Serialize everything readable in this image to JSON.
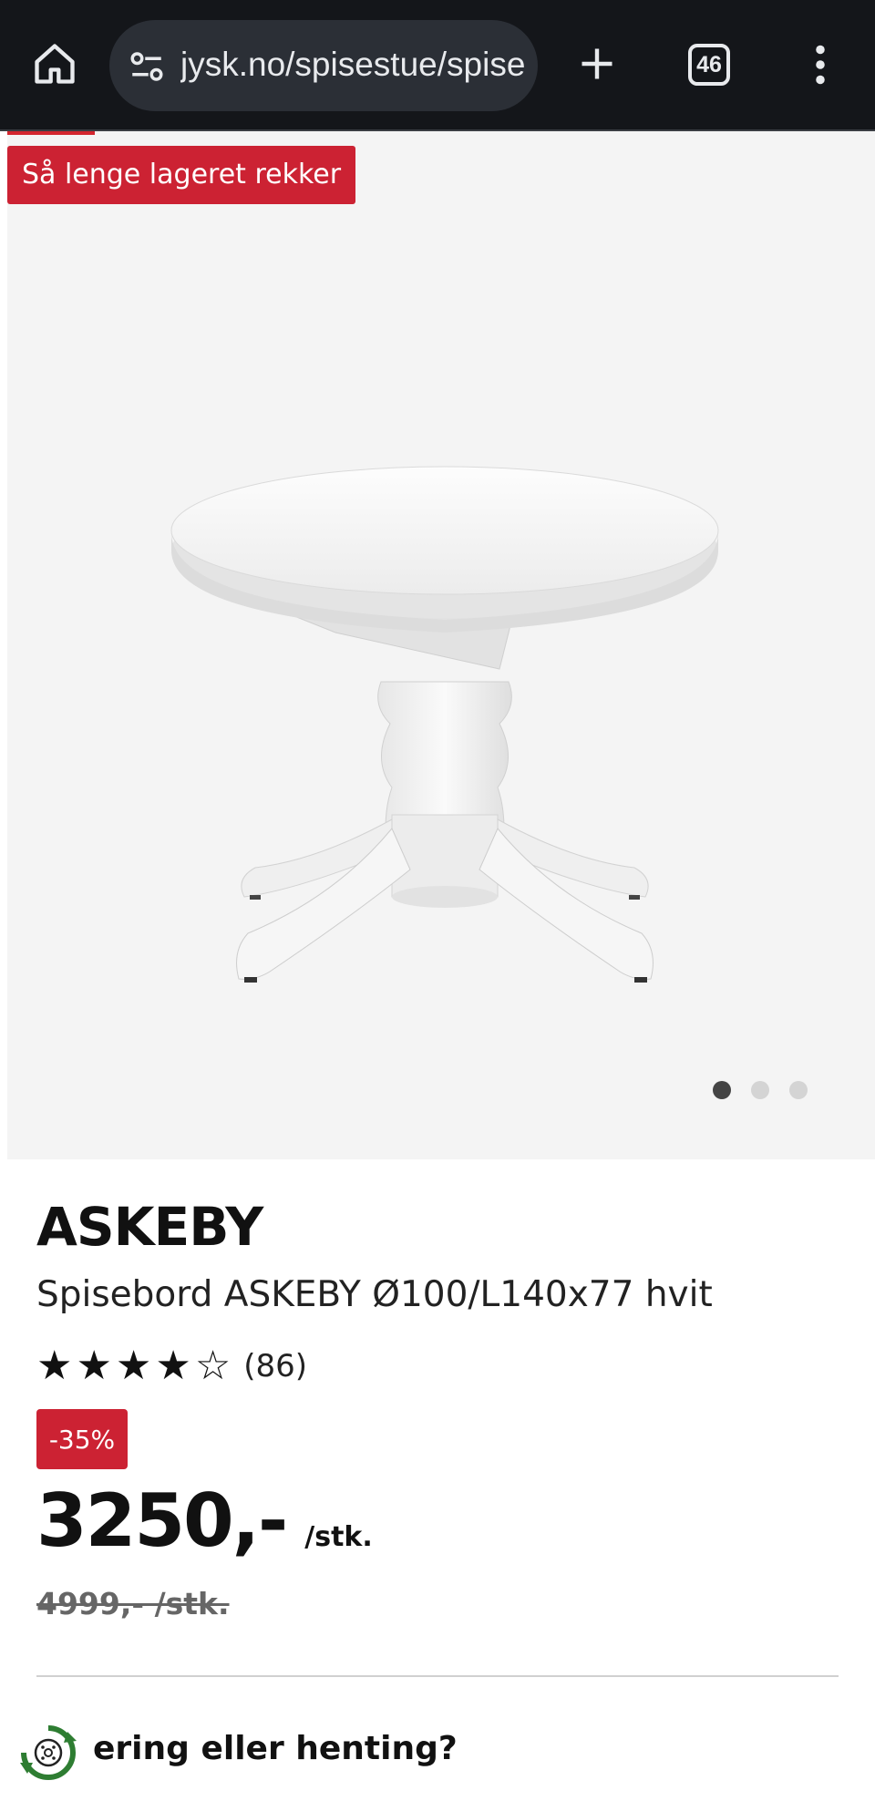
{
  "browser": {
    "url": "jysk.no/spisestue/spise",
    "tab_count": "46",
    "icons": [
      "home-icon",
      "site-settings-icon",
      "plus-icon",
      "tab-switcher-icon",
      "more-vert-icon"
    ]
  },
  "hero": {
    "sale_badge": "Så lenge lageret rekker",
    "image_count": 3,
    "active_image_index": 0
  },
  "product": {
    "brand": "ASKEBY",
    "name": "Spisebord ASKEBY Ø100/L140x77 hvit",
    "rating": 4.5,
    "rating_max": 5,
    "review_count": "(86)",
    "discount": "-35%",
    "price": "3250,-",
    "price_unit": "/stk.",
    "old_price": "4999,- /stk."
  },
  "delivery": {
    "text": "ering eller henting?"
  },
  "colors": {
    "browser_bar": "#14161a",
    "omnibox": "#2b2f36",
    "accent_red": "#cc2233",
    "hero_bg": "#f4f4f4"
  }
}
